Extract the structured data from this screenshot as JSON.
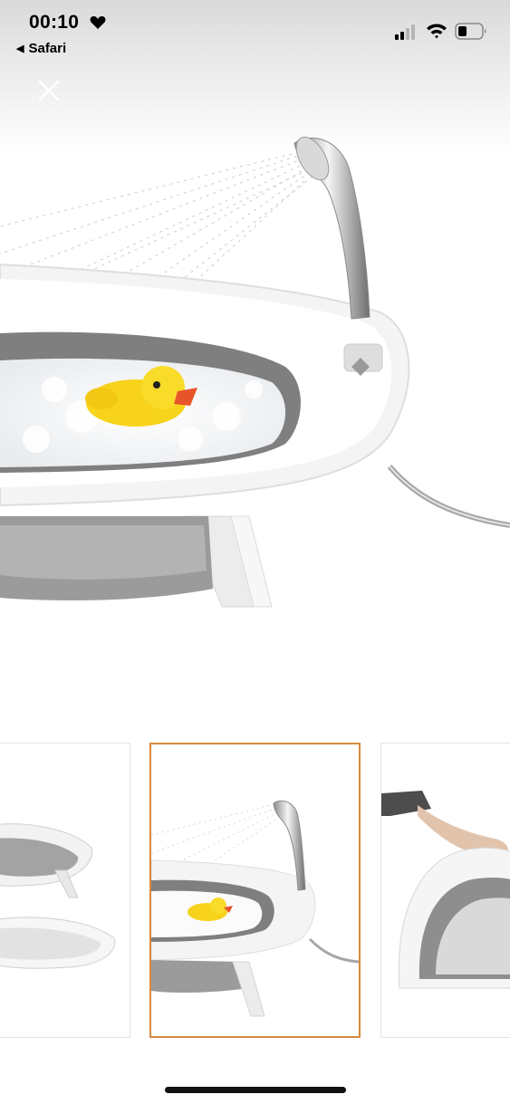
{
  "status_bar": {
    "time": "00:10",
    "back_app": "Safari",
    "icons": [
      "heart-icon",
      "cellular-signal-icon",
      "wifi-icon",
      "battery-icon"
    ]
  },
  "viewer": {
    "close_icon": "close-icon",
    "hero_image": "bathtub-with-shower-and-duck",
    "thumbnails": [
      {
        "image": "two-folding-bathtubs",
        "selected": false
      },
      {
        "image": "bathtub-with-shower-and-duck",
        "selected": true
      },
      {
        "image": "hand-holding-bathtub",
        "selected": false
      }
    ]
  },
  "colors": {
    "selected_border": "#d8893c",
    "tub_white": "#f4f4f4",
    "tub_gray": "#8a8a8a",
    "duck_yellow": "#f7d31c",
    "duck_beak": "#e8542a"
  }
}
